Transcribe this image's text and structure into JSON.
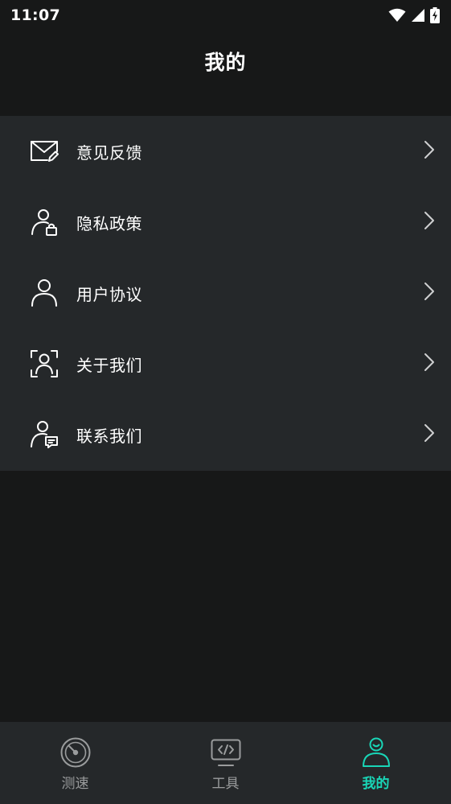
{
  "status_bar": {
    "time": "11:07"
  },
  "header": {
    "title": "我的"
  },
  "menu": {
    "items": [
      {
        "label": "意见反馈",
        "icon": "mail-edit-icon"
      },
      {
        "label": "隐私政策",
        "icon": "user-lock-icon"
      },
      {
        "label": "用户协议",
        "icon": "user-icon"
      },
      {
        "label": "关于我们",
        "icon": "user-frame-icon"
      },
      {
        "label": "联系我们",
        "icon": "user-message-icon"
      }
    ]
  },
  "bottom_nav": {
    "tabs": [
      {
        "label": "测速",
        "icon": "speedometer-icon",
        "active": false
      },
      {
        "label": "工具",
        "icon": "code-monitor-icon",
        "active": false
      },
      {
        "label": "我的",
        "icon": "smile-user-icon",
        "active": true
      }
    ]
  },
  "colors": {
    "background": "#171818",
    "panel": "#25282a",
    "accent": "#19d6b7",
    "inactive": "#9a9c9d",
    "text": "#ffffff"
  }
}
